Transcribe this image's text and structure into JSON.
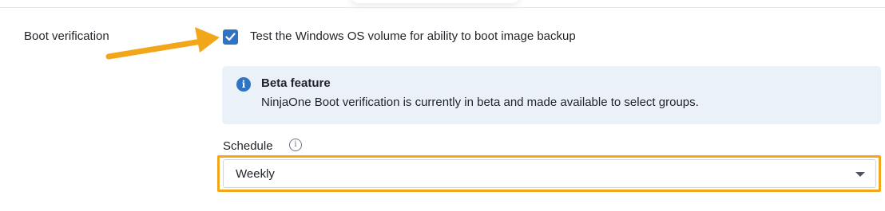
{
  "section": {
    "label": "Boot verification"
  },
  "checkbox": {
    "label": "Test the Windows OS volume for ability to boot image backup",
    "checked": true,
    "color": "#2f73c4",
    "icon": "check-icon"
  },
  "beta_notice": {
    "icon": "info-icon",
    "title": "Beta feature",
    "text": "NinjaOne Boot verification is currently in beta and made available to select groups.",
    "background": "#eaf1f8"
  },
  "schedule": {
    "label": "Schedule",
    "info_icon": "info-outline-icon",
    "selected": "Weekly",
    "caret_icon": "caret-down-icon"
  },
  "annotations": {
    "arrow_color": "#f2a71b",
    "highlight_color": "#f2a71b"
  }
}
